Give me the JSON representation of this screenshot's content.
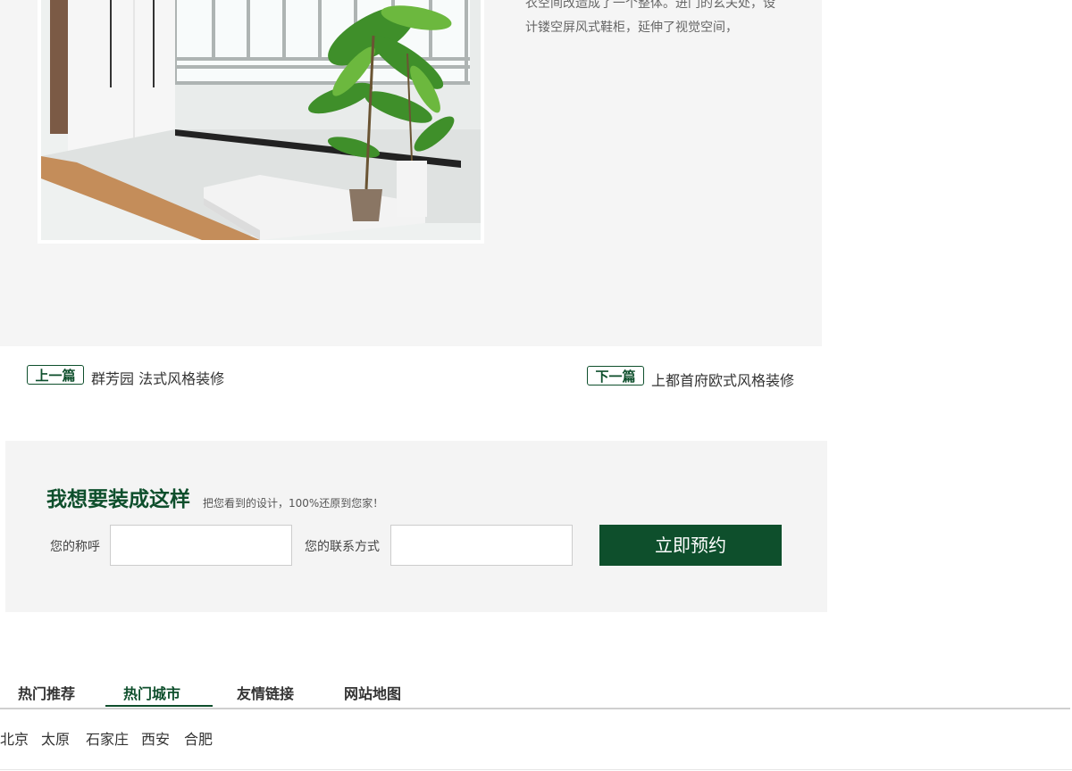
{
  "article": {
    "text_lines": [
      "衣空间改造成了一个整体。进门的玄关处，设",
      "计镂空屏风式鞋柜，延伸了视觉空间，"
    ]
  },
  "prev_next": {
    "prev_tag": "上一篇",
    "prev_title": "群芳园 法式风格装修",
    "next_tag": "下一篇",
    "next_title": "上都首府欧式风格装修"
  },
  "booking": {
    "title": "我想要装成这样",
    "subtitle": "把您看到的设计，100%还原到您家！",
    "name_label": "您的称呼",
    "contact_label": "您的联系方式",
    "submit_label": "立即预约"
  },
  "footer": {
    "tabs": [
      "热门推荐",
      "热门城市",
      "友情链接",
      "网站地图"
    ],
    "active_tab": "热门城市",
    "cities": [
      "北京",
      "太原",
      "石家庄",
      "西安",
      "合肥"
    ]
  },
  "colors": {
    "brand_green": "#0e4f2c",
    "panel_bg": "#f5f5f5"
  }
}
